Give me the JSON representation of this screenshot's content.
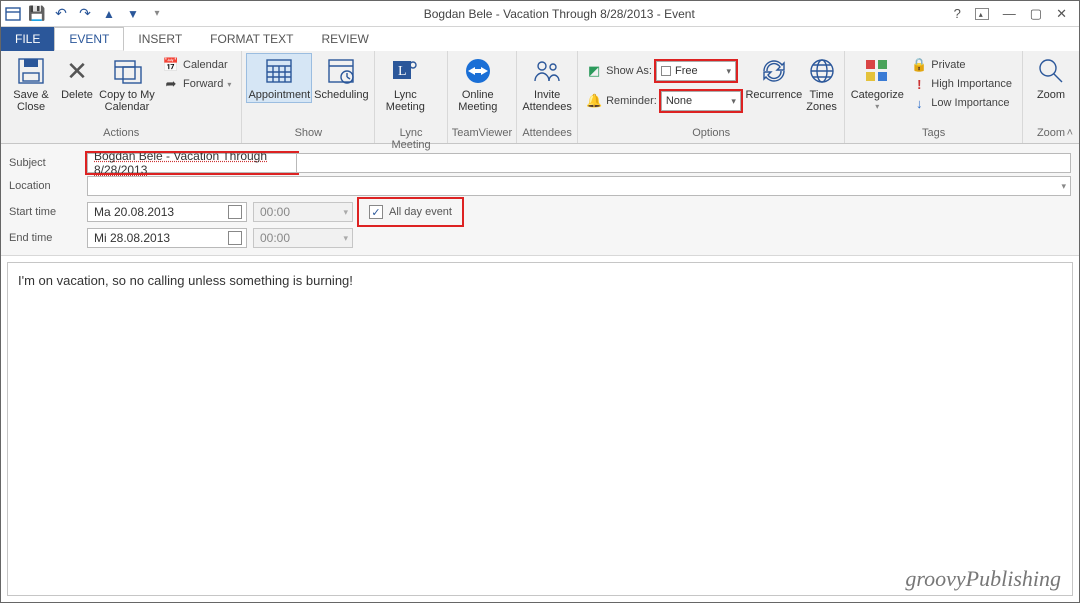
{
  "title": "Bogdan Bele - Vacation Through 8/28/2013 - Event",
  "tabs": {
    "file": "FILE",
    "event": "EVENT",
    "insert": "INSERT",
    "format": "FORMAT TEXT",
    "review": "REVIEW"
  },
  "ribbon": {
    "actions": {
      "save_close": "Save & Close",
      "delete": "Delete",
      "copy_cal": "Copy to My Calendar",
      "calendar": "Calendar",
      "forward": "Forward",
      "label": "Actions"
    },
    "show": {
      "appointment": "Appointment",
      "scheduling": "Scheduling",
      "label": "Show"
    },
    "lync": {
      "btn": "Lync Meeting",
      "label": "Lync Meeting"
    },
    "tv": {
      "btn": "Online Meeting",
      "label": "TeamViewer"
    },
    "att": {
      "btn": "Invite Attendees",
      "label": "Attendees"
    },
    "options": {
      "showas_l": "Show As:",
      "showas_v": "Free",
      "reminder_l": "Reminder:",
      "reminder_v": "None",
      "recurrence": "Recurrence",
      "tz": "Time Zones",
      "label": "Options"
    },
    "tags": {
      "categorize": "Categorize",
      "private": "Private",
      "high": "High Importance",
      "low": "Low Importance",
      "label": "Tags"
    },
    "zoom": {
      "btn": "Zoom",
      "label": "Zoom"
    }
  },
  "form": {
    "subject_l": "Subject",
    "subject_v": "Bogdan Bele - Vacation Through 8/28/2013",
    "location_l": "Location",
    "location_v": "",
    "start_l": "Start time",
    "start_date": "Ma 20.08.2013",
    "start_time": "00:00",
    "end_l": "End time",
    "end_date": "Mi 28.08.2013",
    "end_time": "00:00",
    "allday_l": "All day event",
    "allday_checked": true
  },
  "body": "I'm on vacation, so no calling unless something is burning!",
  "watermark": "groovyPublishing"
}
